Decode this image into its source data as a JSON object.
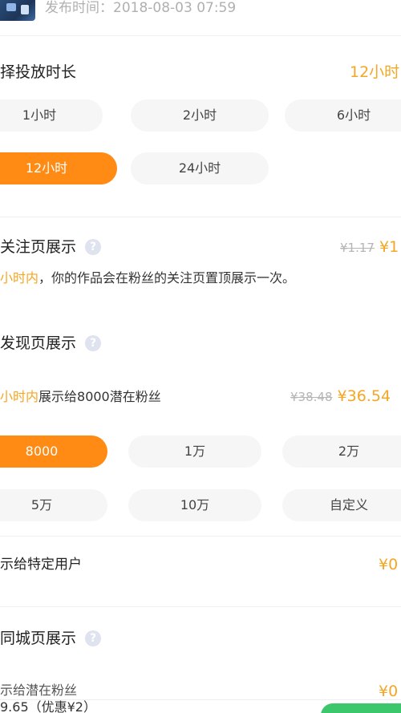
{
  "header": {
    "publish_time": "发布时间：2018-08-03 07:59"
  },
  "duration": {
    "title": "择投放时长",
    "selected_value": "12小时",
    "options": [
      "1小时",
      "2小时",
      "6小时",
      "12小时",
      "24小时"
    ],
    "active_index": 3
  },
  "follow_page": {
    "title": "关注页展示",
    "old_price": "¥1.17",
    "new_price": "¥1",
    "desc_highlight": "小时内",
    "desc_rest": "，你的作品会在粉丝的关注页置顶展示一次。"
  },
  "discover_page": {
    "title": "发现页展示",
    "desc_highlight": "小时内",
    "desc_rest": "展示给8000潜在粉丝",
    "old_price": "¥38.48",
    "new_price": "¥36.54",
    "options": [
      "8000",
      "1万",
      "2万",
      "5万",
      "10万",
      "自定义"
    ],
    "active_index": 0
  },
  "specific_users": {
    "label": "示给特定用户",
    "price": "¥0"
  },
  "local_page": {
    "title": "同城页展示",
    "desc": "示给潜在粉丝",
    "price": "¥0"
  },
  "footer": {
    "total_text": "9.65（优惠¥2）"
  },
  "colors": {
    "accent": "#ff8a14",
    "price": "#f5a623",
    "pay_button": "#3cc76c"
  }
}
